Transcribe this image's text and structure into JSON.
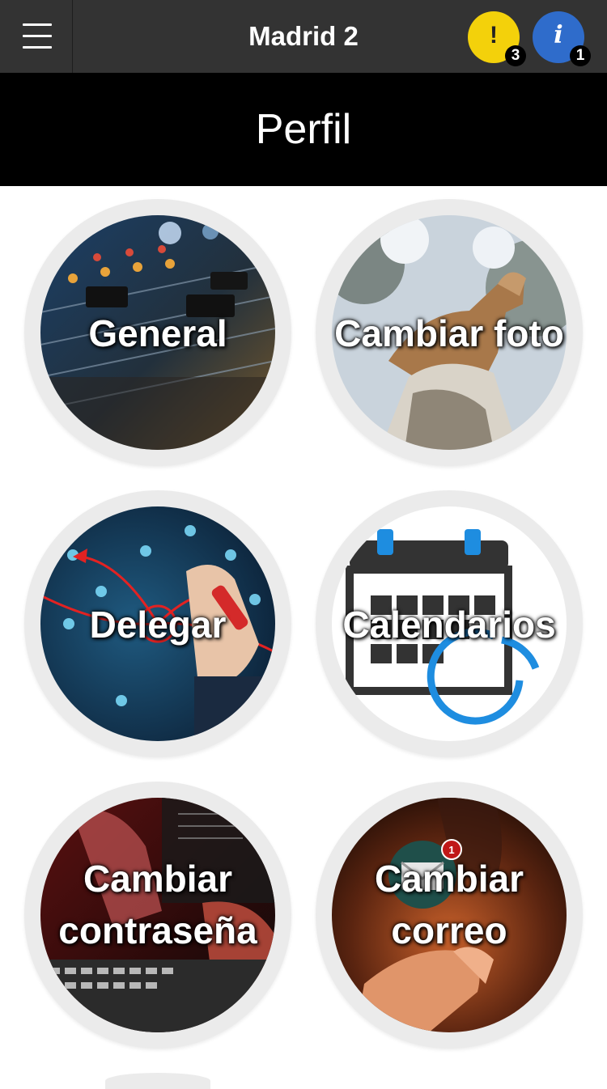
{
  "topbar": {
    "title": "Madrid 2",
    "menu_icon": "hamburger-icon",
    "warnings": {
      "icon": "exclamation-icon",
      "glyph": "!",
      "count": "3",
      "color": "#f3d10b"
    },
    "info": {
      "icon": "info-icon",
      "glyph": "i",
      "count": "1",
      "color": "#2f6ccb"
    }
  },
  "page": {
    "title": "Perfil"
  },
  "tiles": [
    {
      "label": "General",
      "image": "audio-mixer-image"
    },
    {
      "label": "Cambiar foto",
      "image": "cougar-photo-image"
    },
    {
      "label": "Delegar",
      "image": "network-people-image"
    },
    {
      "label": "Calendarios",
      "image": "calendar-sync-icon"
    },
    {
      "label": "Cambiar contraseña",
      "line1": "Cambiar",
      "line2": "contraseña",
      "image": "keyboard-hands-image"
    },
    {
      "label": "Cambiar correo",
      "line1": "Cambiar",
      "line2": "correo",
      "image": "email-touch-image",
      "mail_badge": "1"
    }
  ]
}
